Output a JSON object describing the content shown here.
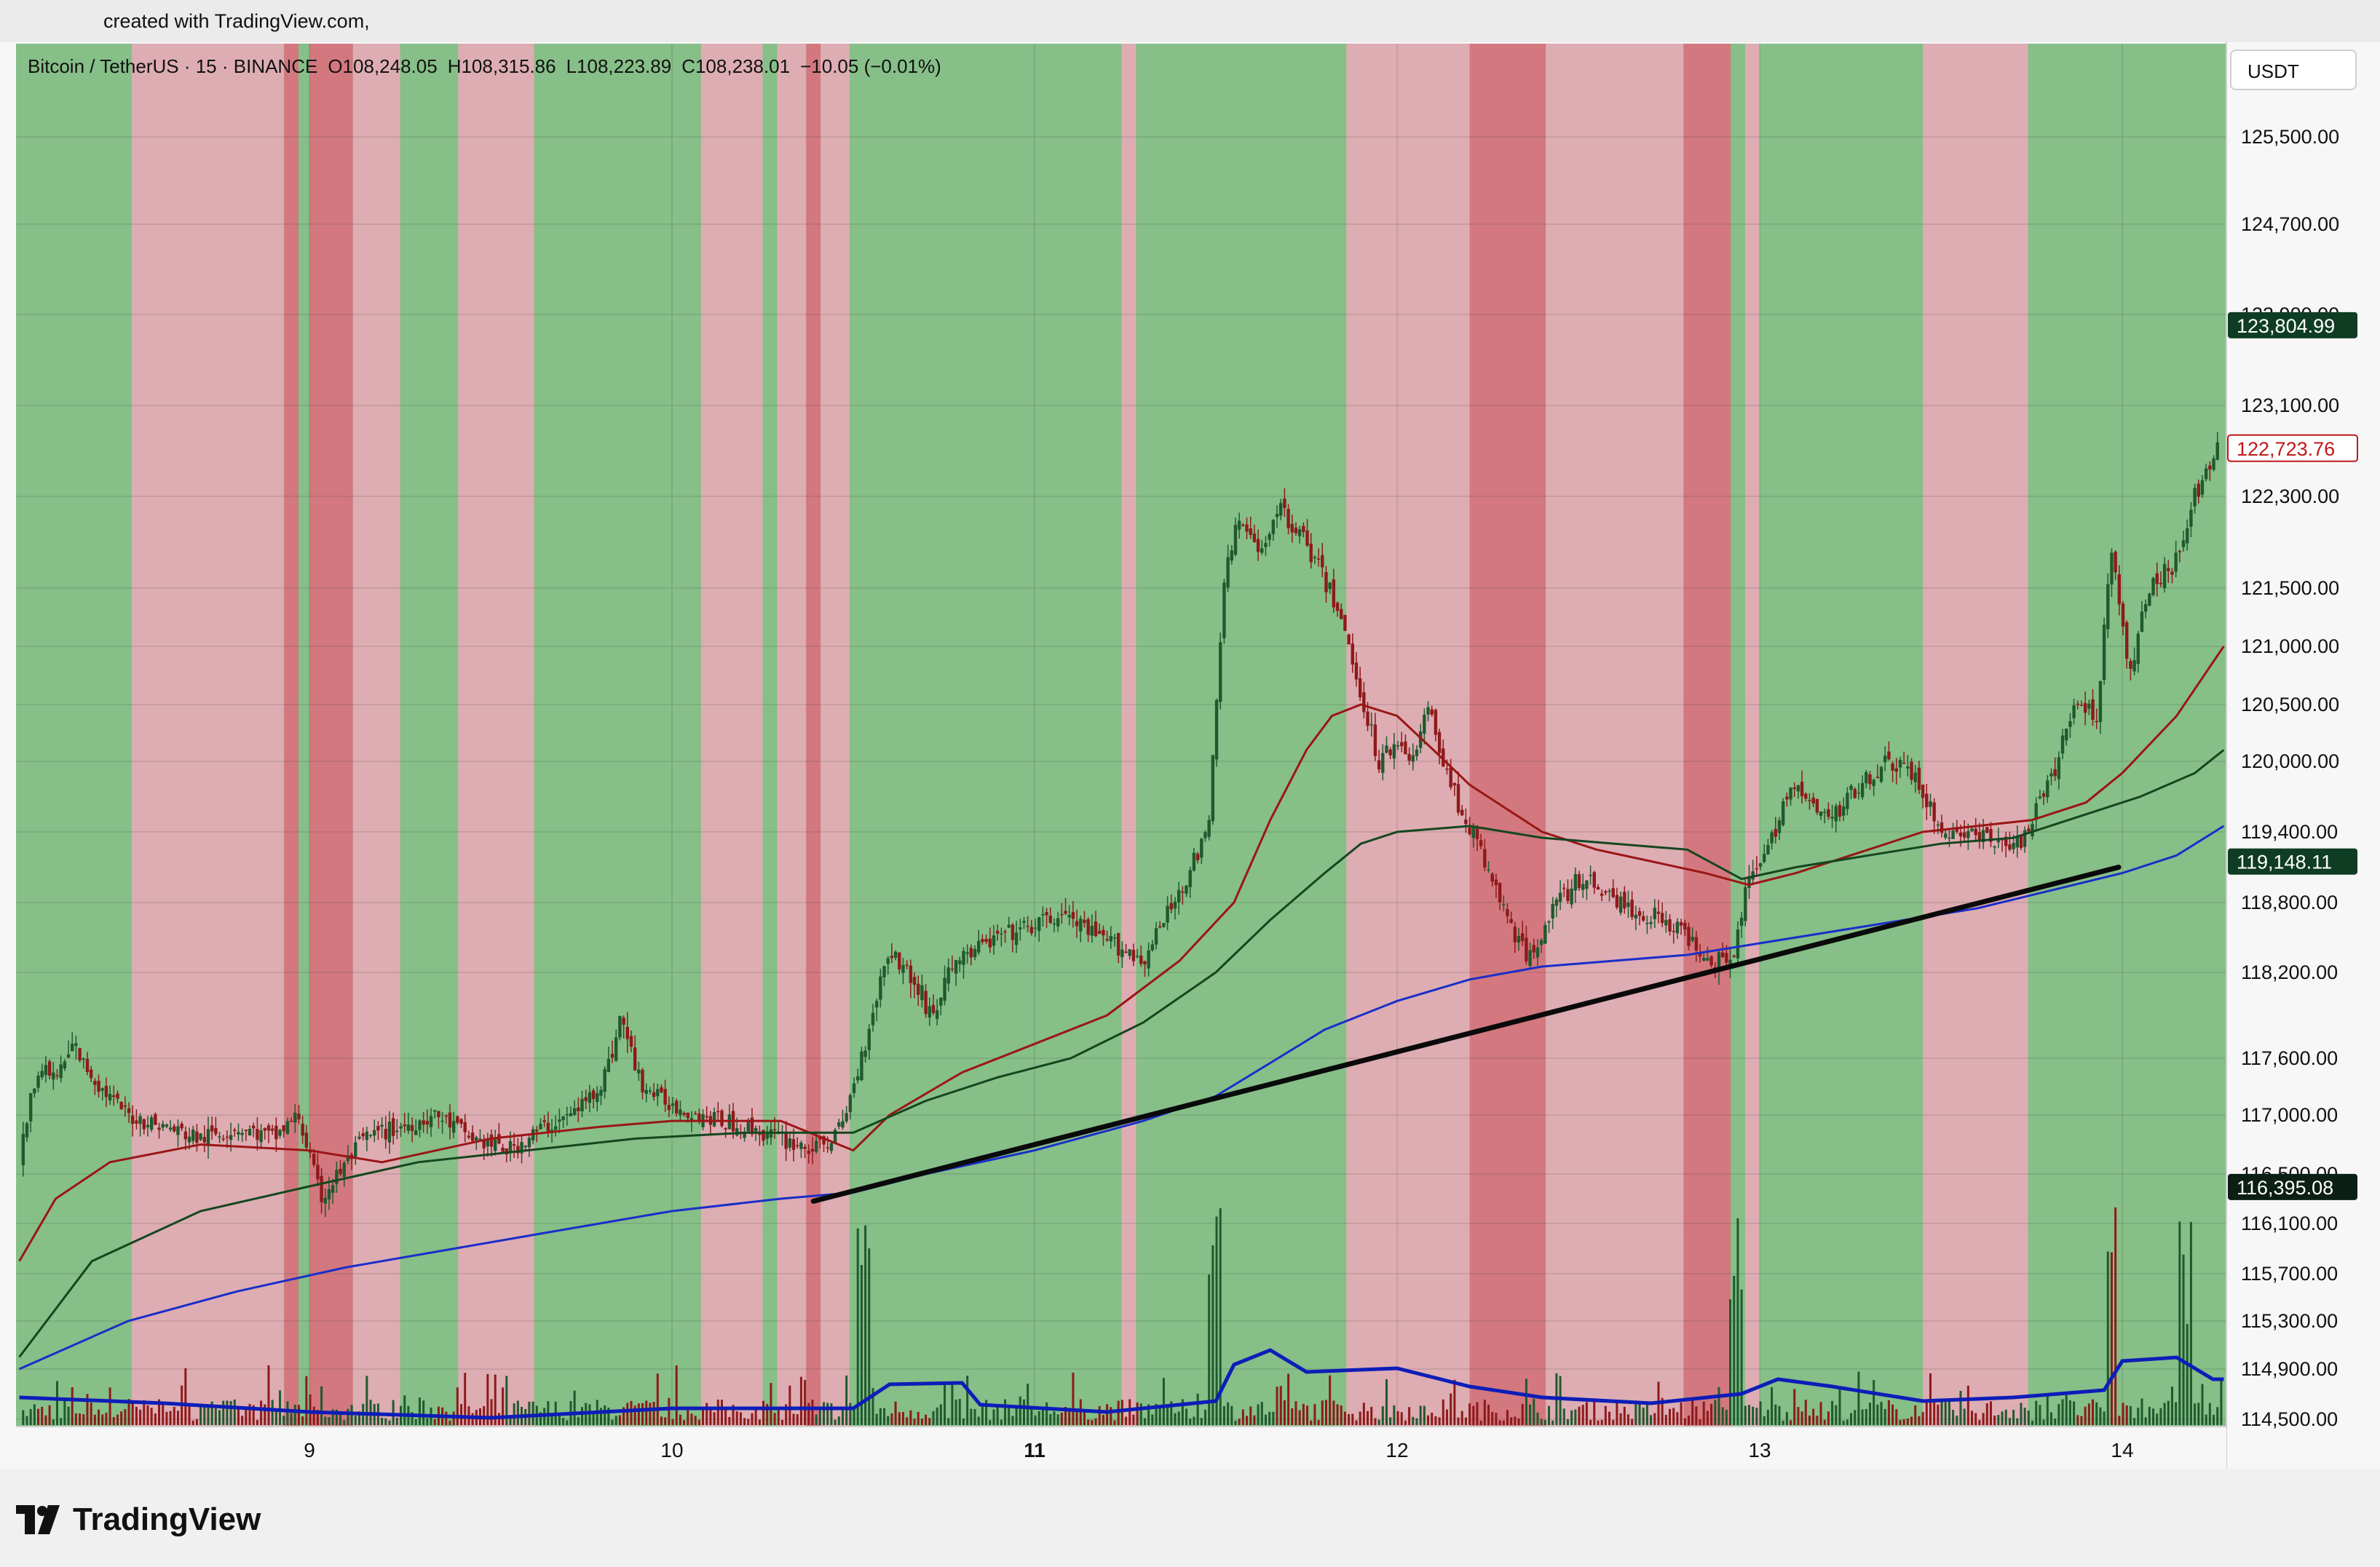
{
  "header": {
    "credit": "created with TradingView.com,"
  },
  "legend": {
    "symbol": "Bitcoin / TetherUS · 15 · BINANCE",
    "open": "O108,248.05",
    "high": "H108,315.86",
    "low": "L108,223.89",
    "close": "C108,238.01",
    "change": "−10.05 (−0.01%)"
  },
  "currency": "USDT",
  "footer": {
    "brand": "TradingView"
  },
  "colors": {
    "bullish_zone": "#86bf88",
    "bearish_zone": "#ddadb3",
    "strong_bearish_zone": "#d3787f",
    "ma_short": "#9b1616",
    "ma_mid": "#15461f",
    "ma_long": "#1a2ec9",
    "trendline": "#0a0a0a",
    "candle_up": "#1f5a2e",
    "candle_down": "#8e1a1a"
  },
  "chart_data": {
    "type": "candlestick",
    "symbol": "BTCUSDT",
    "exchange": "BINANCE",
    "interval": "15",
    "ylim": [
      114500,
      126000
    ],
    "y_ticks": [
      125500,
      124700,
      123900,
      123100,
      122300,
      121500,
      121000,
      120500,
      120000,
      119400,
      118800,
      118200,
      117600,
      117000,
      116500,
      116100,
      115700,
      115300,
      114900,
      114500
    ],
    "y_tick_labels": [
      "125,500.00",
      "124,700.00",
      "123,900.00",
      "123,100.00",
      "122,300.00",
      "121,500.00",
      "121,000.00",
      "120,500.00",
      "120,000.00",
      "119,400.00",
      "118,800.00",
      "118,200.00",
      "117,600.00",
      "117,000.00",
      "116,500.00",
      "116,100.00",
      "115,700.00",
      "115,300.00",
      "114,900.00",
      "114,500.00"
    ],
    "x_ticks": [
      {
        "day": 9,
        "label": "9"
      },
      {
        "day": 10,
        "label": "10"
      },
      {
        "day": 11,
        "label": "11"
      },
      {
        "day": 12,
        "label": "12"
      },
      {
        "day": 13,
        "label": "13"
      },
      {
        "day": 14,
        "label": "14"
      }
    ],
    "xlim_day": [
      8.2,
      14.28
    ],
    "price_labels": [
      {
        "value": 123804.99,
        "label": "123,804.99",
        "style": "dark-green"
      },
      {
        "value": 122723.76,
        "label": "122,723.76",
        "style": "red-outline"
      },
      {
        "value": 119148.11,
        "label": "119,148.11",
        "style": "dark-green"
      },
      {
        "value": 116395.08,
        "label": "116,395.08",
        "style": "dark"
      }
    ],
    "zones": [
      {
        "from": 8.2,
        "to": 8.51,
        "type": "bull"
      },
      {
        "from": 8.51,
        "to": 8.93,
        "type": "bear"
      },
      {
        "from": 8.93,
        "to": 8.97,
        "type": "strong_bear"
      },
      {
        "from": 8.97,
        "to": 9.0,
        "type": "bull"
      },
      {
        "from": 9.0,
        "to": 9.12,
        "type": "strong_bear"
      },
      {
        "from": 9.12,
        "to": 9.25,
        "type": "bear"
      },
      {
        "from": 9.25,
        "to": 9.41,
        "type": "bull"
      },
      {
        "from": 9.41,
        "to": 9.62,
        "type": "bear"
      },
      {
        "from": 9.62,
        "to": 10.08,
        "type": "bull"
      },
      {
        "from": 10.08,
        "to": 10.25,
        "type": "bear"
      },
      {
        "from": 10.25,
        "to": 10.29,
        "type": "bull"
      },
      {
        "from": 10.29,
        "to": 10.37,
        "type": "bear"
      },
      {
        "from": 10.37,
        "to": 10.41,
        "type": "strong_bear"
      },
      {
        "from": 10.41,
        "to": 10.49,
        "type": "bear"
      },
      {
        "from": 10.49,
        "to": 11.24,
        "type": "bull"
      },
      {
        "from": 11.24,
        "to": 11.28,
        "type": "bear"
      },
      {
        "from": 11.28,
        "to": 11.86,
        "type": "bull"
      },
      {
        "from": 11.86,
        "to": 12.2,
        "type": "bear"
      },
      {
        "from": 12.2,
        "to": 12.41,
        "type": "strong_bear"
      },
      {
        "from": 12.41,
        "to": 12.79,
        "type": "bear"
      },
      {
        "from": 12.79,
        "to": 12.92,
        "type": "strong_bear"
      },
      {
        "from": 12.92,
        "to": 12.96,
        "type": "bull"
      },
      {
        "from": 12.96,
        "to": 13.0,
        "type": "bear"
      },
      {
        "from": 13.0,
        "to": 13.45,
        "type": "bull"
      },
      {
        "from": 13.45,
        "to": 13.74,
        "type": "bear"
      },
      {
        "from": 13.74,
        "to": 14.28,
        "type": "bull"
      }
    ],
    "price_path": [
      [
        8.2,
        116600
      ],
      [
        8.25,
        117500
      ],
      [
        8.3,
        117400
      ],
      [
        8.35,
        117700
      ],
      [
        8.42,
        117300
      ],
      [
        8.5,
        117000
      ],
      [
        8.6,
        116900
      ],
      [
        8.7,
        116800
      ],
      [
        8.8,
        116900
      ],
      [
        8.9,
        116800
      ],
      [
        8.97,
        117000
      ],
      [
        9.03,
        116300
      ],
      [
        9.08,
        116500
      ],
      [
        9.15,
        116800
      ],
      [
        9.25,
        116900
      ],
      [
        9.35,
        117000
      ],
      [
        9.45,
        116800
      ],
      [
        9.55,
        116700
      ],
      [
        9.65,
        116900
      ],
      [
        9.72,
        117000
      ],
      [
        9.8,
        117300
      ],
      [
        9.86,
        117900
      ],
      [
        9.92,
        117300
      ],
      [
        10.0,
        117100
      ],
      [
        10.08,
        117000
      ],
      [
        10.2,
        116900
      ],
      [
        10.3,
        116800
      ],
      [
        10.4,
        116700
      ],
      [
        10.47,
        116900
      ],
      [
        10.53,
        117700
      ],
      [
        10.6,
        118400
      ],
      [
        10.65,
        118200
      ],
      [
        10.72,
        117900
      ],
      [
        10.78,
        118300
      ],
      [
        10.9,
        118500
      ],
      [
        11.0,
        118600
      ],
      [
        11.08,
        118700
      ],
      [
        11.17,
        118500
      ],
      [
        11.25,
        118400
      ],
      [
        11.3,
        118300
      ],
      [
        11.4,
        118900
      ],
      [
        11.48,
        119400
      ],
      [
        11.52,
        121500
      ],
      [
        11.56,
        122100
      ],
      [
        11.62,
        121800
      ],
      [
        11.67,
        122200
      ],
      [
        11.73,
        122000
      ],
      [
        11.78,
        121700
      ],
      [
        11.84,
        121300
      ],
      [
        11.9,
        120600
      ],
      [
        11.95,
        120000
      ],
      [
        12.0,
        120200
      ],
      [
        12.05,
        120000
      ],
      [
        12.08,
        120500
      ],
      [
        12.12,
        120100
      ],
      [
        12.16,
        119700
      ],
      [
        12.22,
        119300
      ],
      [
        12.3,
        118700
      ],
      [
        12.36,
        118300
      ],
      [
        12.42,
        118700
      ],
      [
        12.5,
        119000
      ],
      [
        12.58,
        118900
      ],
      [
        12.65,
        118700
      ],
      [
        12.72,
        118700
      ],
      [
        12.8,
        118500
      ],
      [
        12.88,
        118300
      ],
      [
        12.93,
        118400
      ],
      [
        12.97,
        119000
      ],
      [
        13.02,
        119200
      ],
      [
        13.08,
        119800
      ],
      [
        13.15,
        119600
      ],
      [
        13.2,
        119500
      ],
      [
        13.27,
        119800
      ],
      [
        13.35,
        120000
      ],
      [
        13.42,
        119900
      ],
      [
        13.5,
        119400
      ],
      [
        13.58,
        119400
      ],
      [
        13.65,
        119300
      ],
      [
        13.72,
        119300
      ],
      [
        13.8,
        119800
      ],
      [
        13.87,
        120500
      ],
      [
        13.93,
        120400
      ],
      [
        13.97,
        121900
      ],
      [
        14.02,
        120700
      ],
      [
        14.07,
        121500
      ],
      [
        14.14,
        121700
      ],
      [
        14.2,
        122300
      ],
      [
        14.26,
        122700
      ]
    ],
    "series": [
      {
        "name": "",
        "color_key": "ma_short",
        "points": [
          [
            8.2,
            115800
          ],
          [
            8.3,
            116300
          ],
          [
            8.45,
            116600
          ],
          [
            8.7,
            116750
          ],
          [
            9.0,
            116700
          ],
          [
            9.2,
            116600
          ],
          [
            9.5,
            116800
          ],
          [
            9.8,
            116900
          ],
          [
            10.0,
            116950
          ],
          [
            10.3,
            116950
          ],
          [
            10.5,
            116700
          ],
          [
            10.6,
            117000
          ],
          [
            10.8,
            117450
          ],
          [
            11.0,
            117700
          ],
          [
            11.2,
            117900
          ],
          [
            11.4,
            118300
          ],
          [
            11.55,
            118800
          ],
          [
            11.65,
            119500
          ],
          [
            11.75,
            120100
          ],
          [
            11.82,
            120400
          ],
          [
            11.9,
            120500
          ],
          [
            12.0,
            120400
          ],
          [
            12.1,
            120100
          ],
          [
            12.2,
            119800
          ],
          [
            12.3,
            119600
          ],
          [
            12.4,
            119400
          ],
          [
            12.55,
            119250
          ],
          [
            12.7,
            119150
          ],
          [
            12.85,
            119050
          ],
          [
            12.97,
            118950
          ],
          [
            13.1,
            119050
          ],
          [
            13.3,
            119250
          ],
          [
            13.45,
            119400
          ],
          [
            13.6,
            119450
          ],
          [
            13.75,
            119500
          ],
          [
            13.9,
            119650
          ],
          [
            14.0,
            119900
          ],
          [
            14.15,
            120400
          ],
          [
            14.28,
            121000
          ]
        ]
      },
      {
        "name": "",
        "color_key": "ma_mid",
        "points": [
          [
            8.2,
            115000
          ],
          [
            8.4,
            115800
          ],
          [
            8.7,
            116200
          ],
          [
            9.0,
            116400
          ],
          [
            9.3,
            116600
          ],
          [
            9.6,
            116700
          ],
          [
            9.9,
            116800
          ],
          [
            10.2,
            116850
          ],
          [
            10.5,
            116850
          ],
          [
            10.7,
            117150
          ],
          [
            10.9,
            117400
          ],
          [
            11.1,
            117600
          ],
          [
            11.3,
            117850
          ],
          [
            11.5,
            118200
          ],
          [
            11.65,
            118650
          ],
          [
            11.8,
            119050
          ],
          [
            11.9,
            119300
          ],
          [
            12.0,
            119400
          ],
          [
            12.2,
            119450
          ],
          [
            12.4,
            119350
          ],
          [
            12.6,
            119300
          ],
          [
            12.8,
            119250
          ],
          [
            12.95,
            119000
          ],
          [
            13.1,
            119100
          ],
          [
            13.3,
            119200
          ],
          [
            13.5,
            119300
          ],
          [
            13.7,
            119350
          ],
          [
            13.9,
            119550
          ],
          [
            14.05,
            119700
          ],
          [
            14.2,
            119900
          ],
          [
            14.28,
            120100
          ]
        ]
      },
      {
        "name": "",
        "color_key": "ma_long",
        "points": [
          [
            8.2,
            114900
          ],
          [
            8.5,
            115300
          ],
          [
            8.8,
            115550
          ],
          [
            9.1,
            115750
          ],
          [
            9.4,
            115900
          ],
          [
            9.7,
            116050
          ],
          [
            10.0,
            116200
          ],
          [
            10.3,
            116300
          ],
          [
            10.5,
            116350
          ],
          [
            10.7,
            116500
          ],
          [
            11.0,
            116700
          ],
          [
            11.3,
            116950
          ],
          [
            11.5,
            117200
          ],
          [
            11.65,
            117550
          ],
          [
            11.8,
            117800
          ],
          [
            12.0,
            118000
          ],
          [
            12.2,
            118150
          ],
          [
            12.4,
            118250
          ],
          [
            12.6,
            118300
          ],
          [
            12.8,
            118350
          ],
          [
            13.0,
            118450
          ],
          [
            13.2,
            118550
          ],
          [
            13.4,
            118650
          ],
          [
            13.6,
            118750
          ],
          [
            13.8,
            118900
          ],
          [
            14.0,
            119050
          ],
          [
            14.15,
            119200
          ],
          [
            14.28,
            119450
          ]
        ]
      }
    ],
    "trendline": [
      [
        10.39,
        116280
      ],
      [
        13.99,
        119100
      ]
    ],
    "volume_spikes": [
      10.53,
      11.5,
      12.93,
      13.97,
      14.17
    ]
  }
}
